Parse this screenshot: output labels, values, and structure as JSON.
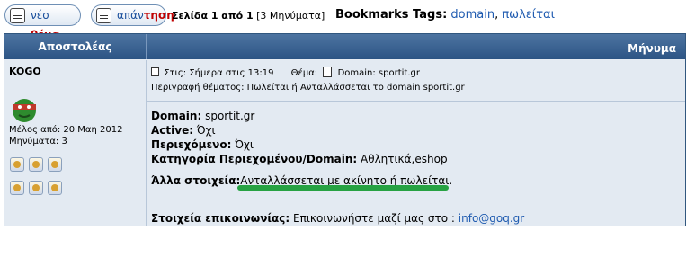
{
  "toolbar": {
    "new_thread_label_part1": "νέο",
    "new_thread_label_part2": "θέμα",
    "reply_label_part1": "απάν",
    "reply_label_part2": "τηση",
    "page_info_prefix": "Σελίδα 1 από 1",
    "page_info_count": "[3 Μηνύματα]",
    "bookmarks_label": "Bookmarks Tags:",
    "bookmark_tags": [
      "domain",
      "πωλείται"
    ]
  },
  "table": {
    "col_author": "Αποστολέας",
    "col_message": "Μήνυμα"
  },
  "post": {
    "author": "KOGO",
    "joined": "Μέλος από: 20 Μαη 2012",
    "posts": "Μηνύματα: 3",
    "meta": {
      "date_label": "Στις:",
      "date_value": "Σήμερα στις 13:19",
      "topic_label": "Θέμα:",
      "topic_value": "Domain: sportit.gr",
      "description": "Περιγραφή θέματος: Πωλείται ή Ανταλλάσσεται το domain sportit.gr"
    },
    "body": {
      "domain_label": "Domain:",
      "domain_value": "sportit.gr",
      "active_label": "Active:",
      "active_value": "Όχι",
      "content_label": "Περιεχόμενο:",
      "content_value": "Όχι",
      "category_label": "Κατηγορία Περιεχομένου/Domain:",
      "category_value": "Αθλητικά,eshop",
      "other_label": "Άλλα στοιχεία:",
      "other_value": "Ανταλλάσσεται με ακίνητο ή πωλείται.",
      "contact_label": "Στοιχεία επικοινωνίας:",
      "contact_value": "Επικοινωνήστε μαζί μας στο :",
      "contact_email": "info@goq.gr"
    }
  },
  "colors": {
    "header_bg": "#2c5484",
    "row_bg": "#e3eaf2",
    "link": "#1f5bb0",
    "highlight": "#27a243"
  }
}
